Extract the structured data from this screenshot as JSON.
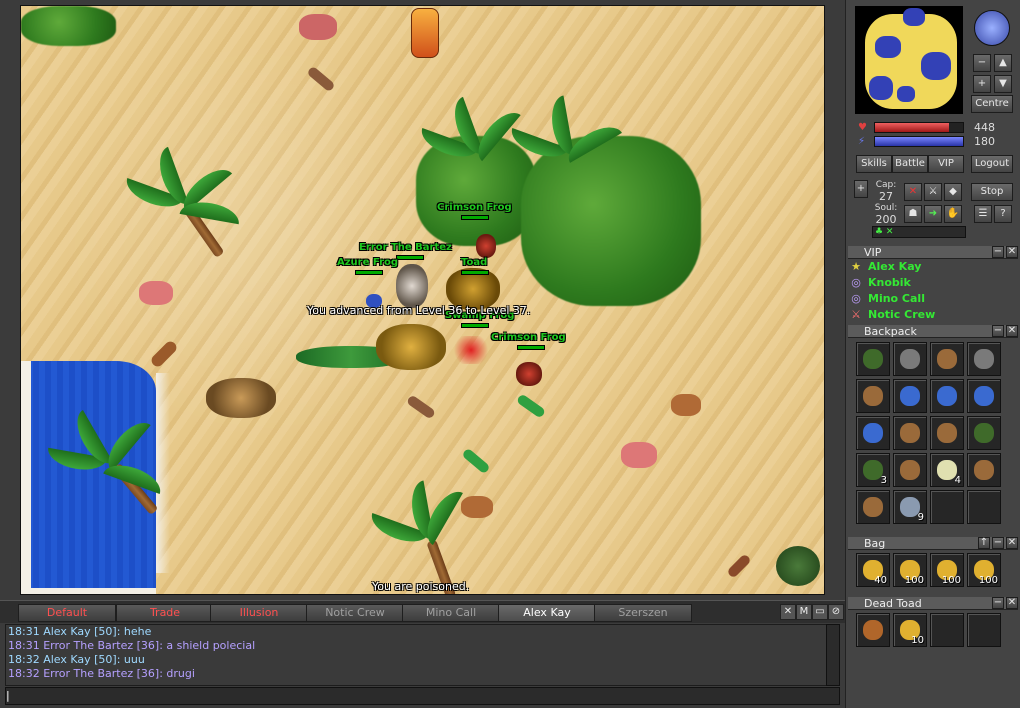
{
  "game": {
    "creatures": [
      {
        "name": "Crimson Frog"
      },
      {
        "name": "Error The Bartez"
      },
      {
        "name": "Azure Frog"
      },
      {
        "name": "Toad"
      },
      {
        "name": "Swamp Frog"
      },
      {
        "name": "Crimson Frog"
      }
    ],
    "messages": {
      "level_up": "You advanced from Level 36 to Level 37.",
      "poisoned": "You are poisoned."
    }
  },
  "chat": {
    "tabs": [
      "Default",
      "Trade",
      "Illusion",
      "Notic Crew",
      "Mino Call",
      "Alex Kay",
      "Szerszen"
    ],
    "buttons": [
      "✕",
      "M",
      "▭",
      "⊘"
    ],
    "lines": [
      "18:31 Alex Kay [50]: hehe",
      "18:31 Error The Bartez [36]: a shield polecial",
      "18:32 Alex Kay [50]: uuu",
      "18:32 Error The Bartez [36]: drugi"
    ],
    "input": "|"
  },
  "side": {
    "centre": "Centre",
    "hp": 448,
    "mana": 180,
    "hp_fill": 0.84,
    "mana_fill": 1.0,
    "buttons": {
      "skills": "Skills",
      "battle": "Battle",
      "vip": "VIP",
      "logout": "Logout",
      "stop": "Stop"
    },
    "cap_label": "Cap:",
    "cap": "27",
    "soul_label": "Soul:",
    "soul": "200",
    "vip_title": "VIP",
    "vip": [
      "Alex Kay",
      "Knobik",
      "Mino Call",
      "Notic Crew"
    ],
    "backpack_title": "Backpack",
    "backpack_counts": [
      "",
      "",
      "",
      "",
      "",
      "",
      "",
      "",
      "",
      "",
      "",
      "",
      "3",
      "",
      "4",
      "",
      "",
      "9",
      "",
      ""
    ],
    "bag_title": "Bag",
    "bag_counts": [
      "40",
      "100",
      "100",
      "100"
    ],
    "dead_title": "Dead Toad",
    "dead_counts": [
      "",
      "10",
      "",
      ""
    ]
  },
  "colors": {
    "hp": "#d23a3a",
    "mana": "#4a55d8",
    "green_name": "#1fc81f"
  }
}
